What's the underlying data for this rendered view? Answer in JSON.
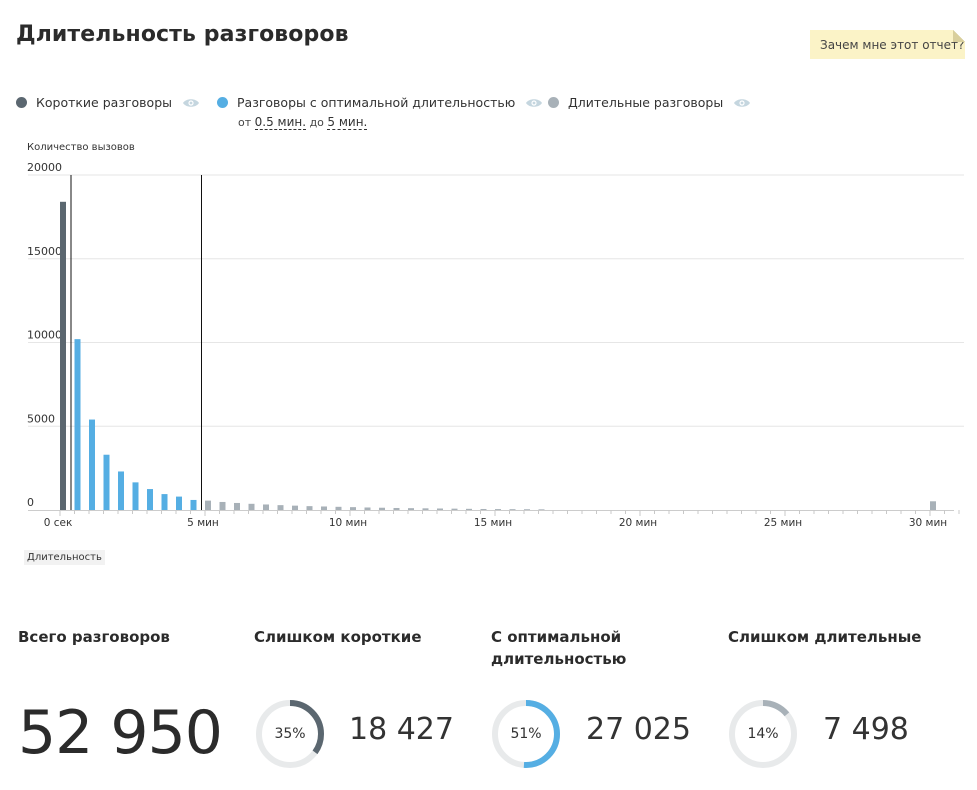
{
  "page": {
    "title": "Длительность разговоров"
  },
  "help": {
    "label": "Зачем мне этот отчет?"
  },
  "legend": {
    "short": {
      "label": "Короткие разговоры",
      "color": "#5b6770",
      "icon": "eye-icon"
    },
    "optimal": {
      "label": "Разговоры с оптимальной длительностью",
      "color": "#55aee3",
      "icon": "eye-icon",
      "range_from_prefix": "от",
      "range_from": "0.5 мин.",
      "range_to_prefix": "до",
      "range_to": "5 мин."
    },
    "long": {
      "label": "Длительные разговоры",
      "color": "#a8b1b8",
      "icon": "eye-icon"
    }
  },
  "chart_data": {
    "type": "bar",
    "ylabel": "Количество вызовов",
    "xlabel": "Длительность",
    "ylim": [
      0,
      20000
    ],
    "y_ticks": [
      0,
      5000,
      10000,
      15000,
      20000
    ],
    "x_tick_labels": [
      "0 сек",
      "5 мин",
      "10 мин",
      "15 мин",
      "20 мин",
      "25 мин",
      "30 мин"
    ],
    "x_unit": "минуты",
    "bin_width_min": 0.5,
    "threshold_lines_min": [
      0.5,
      5
    ],
    "series": [
      {
        "name": "Короткие разговоры",
        "color": "#5b6770",
        "bins_start_min": [
          0
        ],
        "values": [
          18400
        ]
      },
      {
        "name": "Разговоры с оптимальной длительностью",
        "color": "#55aee3",
        "bins_start_min": [
          0.5,
          1,
          1.5,
          2,
          2.5,
          3,
          3.5,
          4,
          4.5
        ],
        "values": [
          10200,
          5400,
          3300,
          2300,
          1650,
          1250,
          950,
          800,
          600
        ]
      },
      {
        "name": "Длительные разговоры",
        "color": "#a8b1b8",
        "bins_start_min": [
          5,
          5.5,
          6,
          6.5,
          7,
          7.5,
          8,
          8.5,
          9,
          9.5,
          10,
          10.5,
          11,
          11.5,
          12,
          12.5,
          13,
          13.5,
          14,
          14.5,
          15,
          15.5,
          16,
          16.5,
          30
        ],
        "values": [
          560,
          480,
          420,
          370,
          330,
          290,
          260,
          230,
          210,
          190,
          170,
          150,
          135,
          120,
          110,
          100,
          90,
          80,
          70,
          60,
          55,
          50,
          45,
          40,
          520
        ]
      }
    ]
  },
  "stats": {
    "total": {
      "title": "Всего разговоров",
      "value": "52 950"
    },
    "short": {
      "title": "Слишком короткие",
      "percent": "35%",
      "percent_value": 0.35,
      "value": "18 427",
      "color": "#5b6770"
    },
    "optimal": {
      "title": "С оптимальной длительностью",
      "percent": "51%",
      "percent_value": 0.51,
      "value": "27 025",
      "color": "#55aee3"
    },
    "long": {
      "title": "Слишком длительные",
      "percent": "14%",
      "percent_value": 0.14,
      "value": "7 498",
      "color": "#a8b1b8"
    }
  }
}
